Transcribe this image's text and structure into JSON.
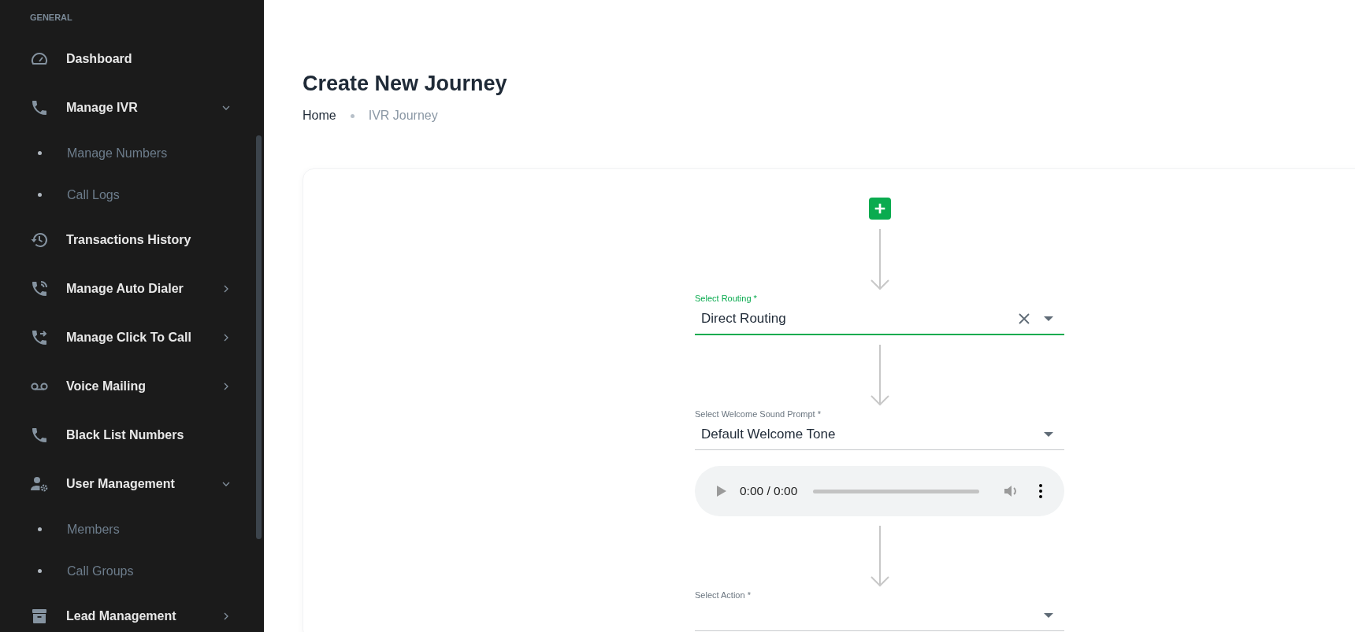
{
  "sidebar": {
    "section_title": "GENERAL",
    "items": [
      {
        "kind": "link",
        "label": "Dashboard"
      },
      {
        "kind": "group",
        "label": "Manage IVR",
        "expanded": true,
        "children": [
          {
            "label": "Manage Numbers"
          },
          {
            "label": "Call Logs"
          }
        ]
      },
      {
        "kind": "link",
        "label": "Transactions History"
      },
      {
        "kind": "group",
        "label": "Manage Auto Dialer",
        "expanded": false
      },
      {
        "kind": "group",
        "label": "Manage Click To Call",
        "expanded": false
      },
      {
        "kind": "group",
        "label": "Voice Mailing",
        "expanded": false
      },
      {
        "kind": "link",
        "label": "Black List Numbers"
      },
      {
        "kind": "group",
        "label": "User Management",
        "expanded": true,
        "children": [
          {
            "label": "Members"
          },
          {
            "label": "Call Groups"
          }
        ]
      },
      {
        "kind": "group",
        "label": "Lead Management",
        "expanded": false
      }
    ]
  },
  "page": {
    "title": "Create New Journey",
    "breadcrumb": [
      "Home",
      "IVR Journey"
    ]
  },
  "journey": {
    "steps": [
      {
        "kind": "add"
      },
      {
        "kind": "select",
        "label": "Select Routing *",
        "value": "Direct Routing",
        "focused": true,
        "clearable": true
      },
      {
        "kind": "select",
        "label": "Select Welcome Sound Prompt *",
        "value": "Default Welcome Tone",
        "focused": false,
        "clearable": false
      },
      {
        "kind": "audio",
        "time": "0:00 / 0:00"
      },
      {
        "kind": "select",
        "label": "Select Action *",
        "focused": false,
        "clearable": false
      }
    ]
  }
}
